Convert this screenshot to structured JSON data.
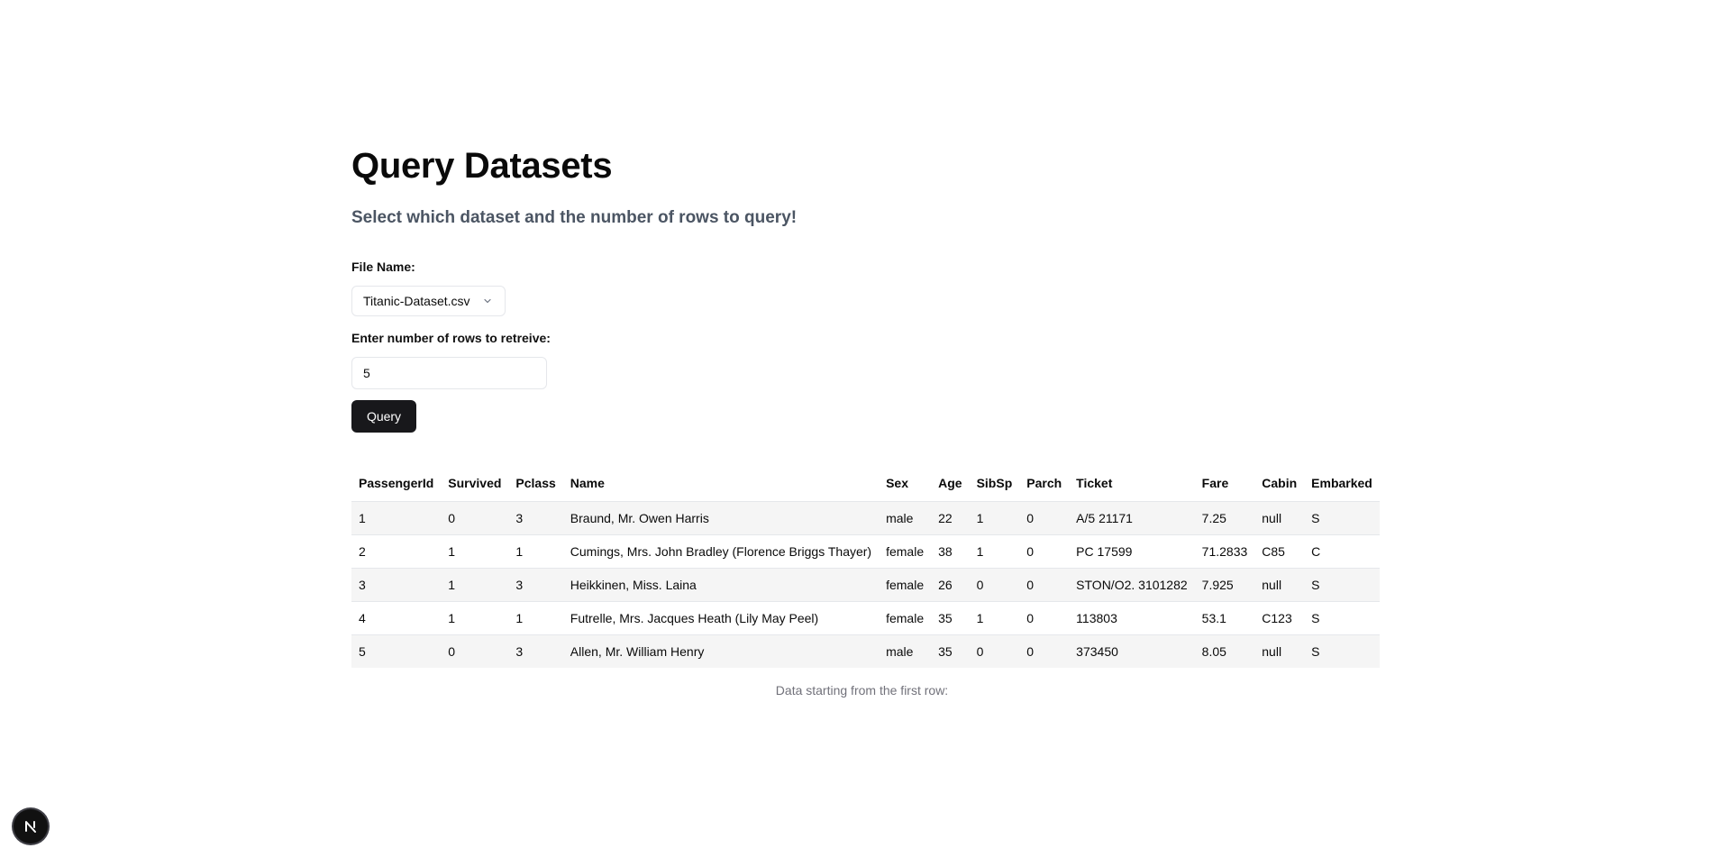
{
  "header": {
    "title": "Query Datasets",
    "subtitle": "Select which dataset and the number of rows to query!"
  },
  "form": {
    "file_label": "File Name:",
    "file_value": "Titanic-Dataset.csv",
    "rows_label": "Enter number of rows to retreive:",
    "rows_value": "5",
    "query_label": "Query"
  },
  "table": {
    "columns": [
      "PassengerId",
      "Survived",
      "Pclass",
      "Name",
      "Sex",
      "Age",
      "SibSp",
      "Parch",
      "Ticket",
      "Fare",
      "Cabin",
      "Embarked"
    ],
    "rows": [
      [
        "1",
        "0",
        "3",
        "Braund, Mr. Owen Harris",
        "male",
        "22",
        "1",
        "0",
        "A/5 21171",
        "7.25",
        "null",
        "S"
      ],
      [
        "2",
        "1",
        "1",
        "Cumings, Mrs. John Bradley (Florence Briggs Thayer)",
        "female",
        "38",
        "1",
        "0",
        "PC 17599",
        "71.2833",
        "C85",
        "C"
      ],
      [
        "3",
        "1",
        "3",
        "Heikkinen, Miss. Laina",
        "female",
        "26",
        "0",
        "0",
        "STON/O2. 3101282",
        "7.925",
        "null",
        "S"
      ],
      [
        "4",
        "1",
        "1",
        "Futrelle, Mrs. Jacques Heath (Lily May Peel)",
        "female",
        "35",
        "1",
        "0",
        "113803",
        "53.1",
        "C123",
        "S"
      ],
      [
        "5",
        "0",
        "3",
        "Allen, Mr. William Henry",
        "male",
        "35",
        "0",
        "0",
        "373450",
        "8.05",
        "null",
        "S"
      ]
    ],
    "caption": "Data starting from the first row:"
  },
  "badge": {
    "icon": "nextjs-logo-icon"
  },
  "colors": {
    "button_bg": "#18181b",
    "subtitle": "#4b5563",
    "border": "#e5e7eb",
    "row_alt": "#f5f5f5"
  }
}
